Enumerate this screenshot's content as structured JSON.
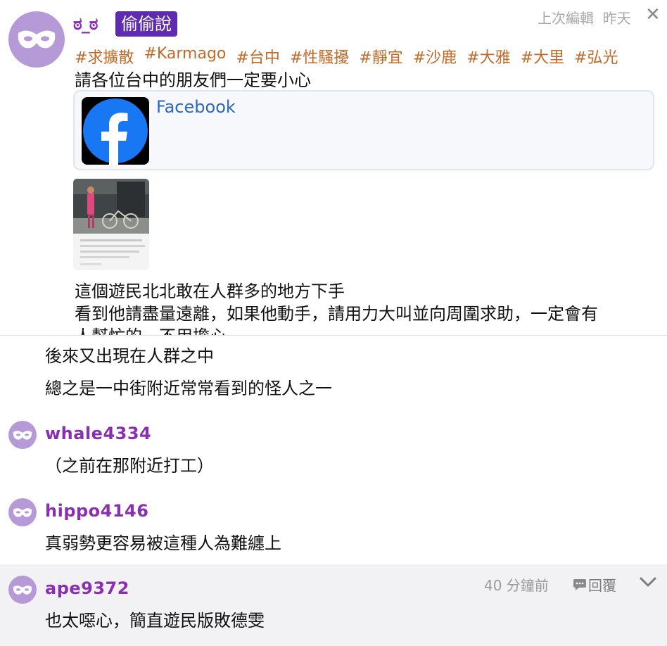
{
  "post": {
    "emote": "ಠ_ಠ",
    "badge": "偷偷說",
    "edited_label": "上次編輯",
    "edited_when": "昨天",
    "close": "✕",
    "tags": [
      "#求擴散",
      "#Karmago",
      "#台中",
      "#性騷擾",
      "#靜宜",
      "#沙鹿",
      "#大雅",
      "#大里",
      "#弘光"
    ],
    "line1": "請各位台中的朋友們一定要小心",
    "link_card": {
      "title": "Facebook",
      "icon": "facebook-logo-icon"
    },
    "line2": "這個遊民北北敢在人群多的地方下手",
    "line3": "看到他請盡量遠離，如果他動手，請用力大叫並向周圍求助，一定會有",
    "line4": "人幫忙的，不用擔心"
  },
  "thread": {
    "continued_1": "後來又出現在人群之中",
    "continued_2": "總之是一中街附近常常看到的怪人之一",
    "comments": [
      {
        "user": "whale4334",
        "text": "（之前在那附近打工）"
      },
      {
        "user": "hippo4146",
        "text": "真弱勢更容易被這種人為難纏上"
      },
      {
        "user": "ape9372",
        "text": "也太噁心，簡直遊民版敗德雯",
        "time": "40 分鐘前",
        "reply": "回覆"
      }
    ]
  },
  "colors": {
    "username": "#8a2fb0",
    "tag": "#c26a27",
    "badge_bg": "#5f2bb1",
    "avatar_bg": "#b69ad8",
    "link": "#2d68c6"
  }
}
